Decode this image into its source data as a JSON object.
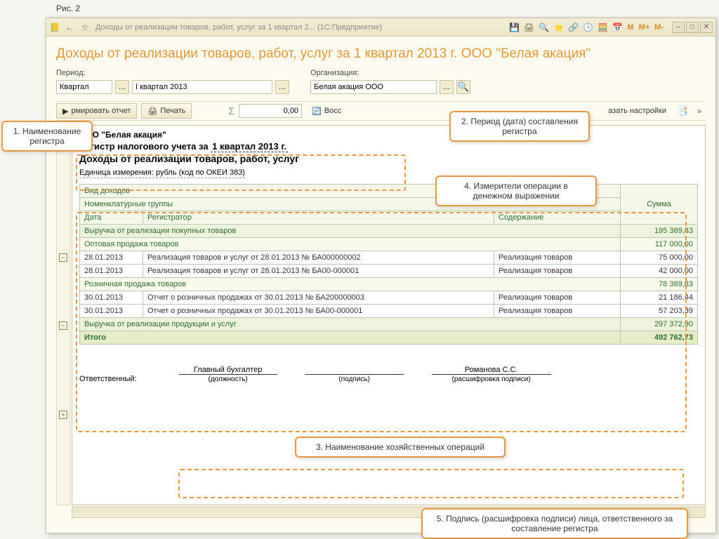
{
  "fig": "Рис. 2",
  "window_title": "Доходы от реализации товаров, работ, услуг за 1 квартал 2...   (1С:Предприятие)",
  "calc_buttons": {
    "m": "M",
    "mplus": "M+",
    "mminus": "M-"
  },
  "doc_title": "Доходы от реализации товаров, работ, услуг за 1 квартал 2013 г. ООО \"Белая акация\"",
  "filters": {
    "period_label": "Период:",
    "period_kind": "Квартал",
    "period_value": "I квартал 2013",
    "org_label": "Организация:",
    "org_value": "Белая акация ООО"
  },
  "toolbar": {
    "form_report": "рмировать отчет",
    "print": "Печать",
    "sigma": "Σ",
    "sum_value": "0,00",
    "restore": "Восс",
    "show_settings": "азать настройки"
  },
  "report": {
    "org": "ООО \"Белая акация\"",
    "line1_prefix": "Регистр налогового учета за ",
    "line1_period": "1 квартал 2013 г.",
    "line2": "Доходы от реализации товаров, работ, услуг",
    "unit": "Единица измерения:   рубль (код по ОКЕИ 383)",
    "headers": {
      "income_type": "Вид доходов",
      "nom_groups": "Номенклатурные группы",
      "date": "Дата",
      "registrator": "Регистратор",
      "content": "Содержание",
      "sum": "Сумма"
    },
    "group1_a": {
      "name": "Выручка от реализации покупных товаров",
      "sum": "195 389,83"
    },
    "group2_a": {
      "name": "Оптовая продажа товаров",
      "sum": "117 000,00"
    },
    "rows_a": [
      {
        "date": "28.01.2013",
        "reg": "Реализация товаров и услуг от 28.01.2013 № БА000000002",
        "content": "Реализация товаров",
        "sum": "75 000,00"
      },
      {
        "date": "28.01.2013",
        "reg": "Реализация товаров и услуг от 28.01.2013 № БА00-000001",
        "content": "Реализация товаров",
        "sum": "42 000,00"
      }
    ],
    "group2_b": {
      "name": "Розничная продажа товаров",
      "sum": "78 389,83"
    },
    "rows_b": [
      {
        "date": "30.01.2013",
        "reg": "Отчет о розничных продажах от 30.01.2013 № БА200000003",
        "content": "Реализация товаров",
        "sum": "21 186,44"
      },
      {
        "date": "30.01.2013",
        "reg": "Отчет о розничных продажах от 30.01.2013 № БА00-000001",
        "content": "Реализация товаров",
        "sum": "57 203,39"
      }
    ],
    "group1_b": {
      "name": "Выручка от реализации продукции и услуг",
      "sum": "297 372,90"
    },
    "total": {
      "label": "Итого",
      "sum": "492 762,73"
    },
    "sign": {
      "resp": "Ответственный:",
      "position_value": "Главный бухгалтер",
      "position_label": "(должность)",
      "sign_label": "(подпись)",
      "name_value": "Романова С.С.",
      "name_label": "(расшифровка подписи)"
    }
  },
  "callouts": {
    "c1": "1. Наименование регистра",
    "c2": "2. Период (дата) составления регистра",
    "c3": "3. Наименование хозяйственных операций",
    "c4": "4. Измерители операции в денежном выражении",
    "c5": "5. Подпись (расшифровка подписи) лица, ответственного за составление регистра"
  }
}
